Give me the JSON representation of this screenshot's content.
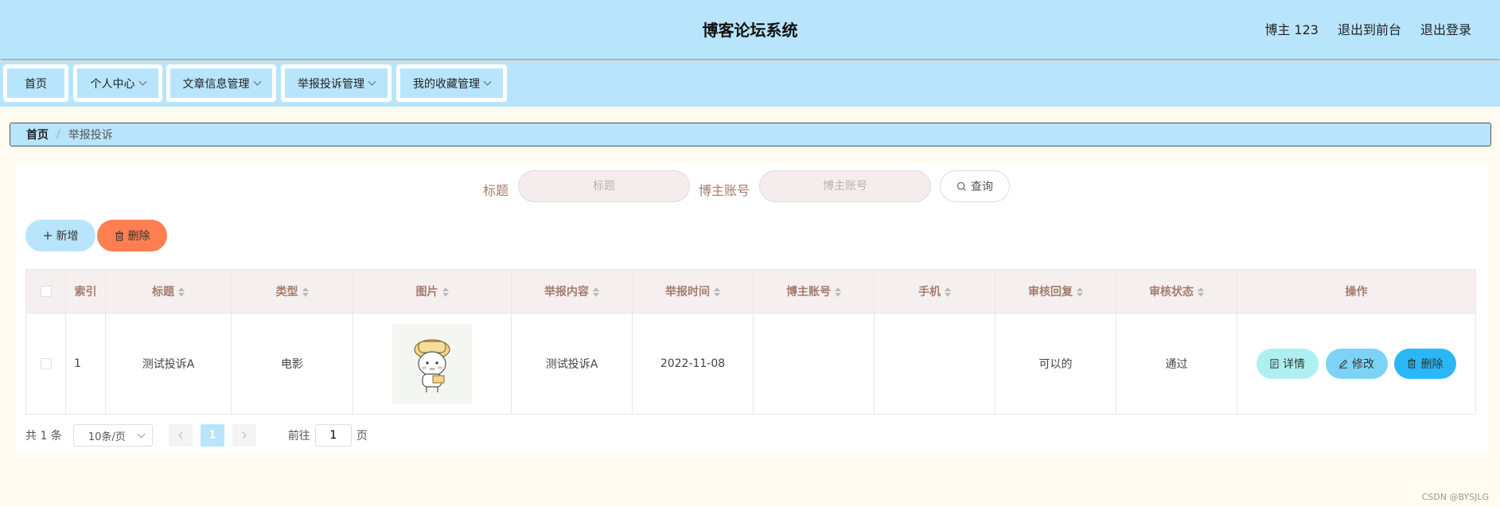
{
  "header": {
    "title": "博客论坛系统",
    "user": "博主 123",
    "to_front": "退出到前台",
    "logout": "退出登录"
  },
  "nav": {
    "items": [
      {
        "label": "首页"
      },
      {
        "label": "个人中心"
      },
      {
        "label": "文章信息管理"
      },
      {
        "label": "举报投诉管理"
      },
      {
        "label": "我的收藏管理"
      }
    ]
  },
  "breadcrumb": {
    "home": "首页",
    "separator": "/",
    "current": "举报投诉"
  },
  "search": {
    "title_label": "标题",
    "title_placeholder": "标题",
    "account_label": "博主账号",
    "account_placeholder": "博主账号",
    "query_label": "查询"
  },
  "actions": {
    "add_label": "新增",
    "delete_label": "删除"
  },
  "table": {
    "columns": [
      "索引",
      "标题",
      "类型",
      "图片",
      "举报内容",
      "举报时间",
      "博主账号",
      "手机",
      "审核回复",
      "审核状态",
      "操作"
    ],
    "rows": [
      {
        "index": "1",
        "title": "测试投诉A",
        "type": "电影",
        "content": "测试投诉A",
        "time": "2022-11-08",
        "account": "",
        "phone": "",
        "reply": "可以的",
        "status": "通过"
      }
    ],
    "op_detail": "详情",
    "op_edit": "修改",
    "op_delete": "删除"
  },
  "pagination": {
    "total": "共 1 条",
    "page_size": "10条/页",
    "current_page": "1",
    "goto_prefix": "前往",
    "goto_value": "1",
    "goto_suffix": "页"
  },
  "watermark": "CSDN @BYSJLG",
  "colors": {
    "primary": "#b8e5fb",
    "danger": "#ff7f50",
    "label": "#a67c6d",
    "background": "#fffbf0"
  }
}
